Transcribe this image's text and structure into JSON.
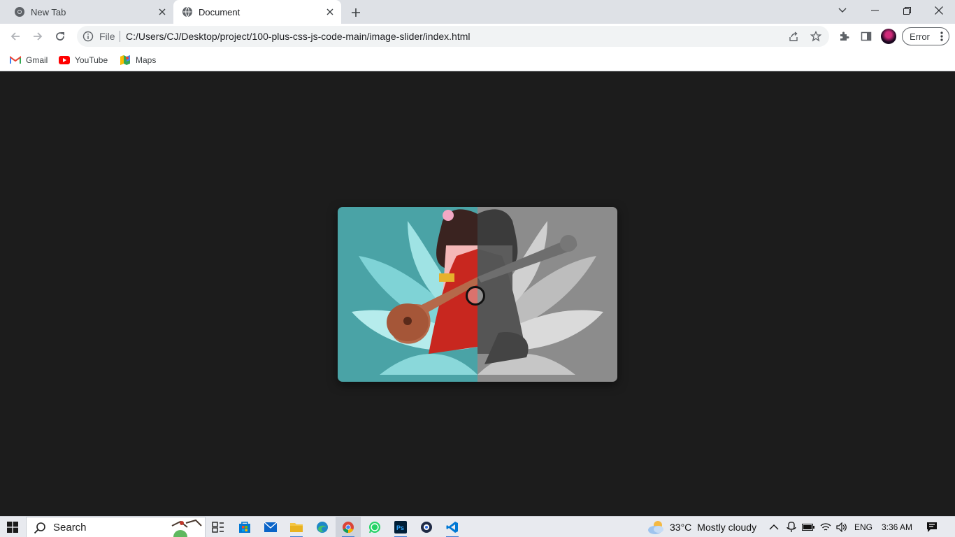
{
  "browser": {
    "tabs": [
      {
        "title": "New Tab",
        "active": false
      },
      {
        "title": "Document",
        "active": true
      }
    ],
    "address": {
      "scheme_label": "File",
      "url": "C:/Users/CJ/Desktop/project/100-plus-css-js-code-main/image-slider/index.html"
    },
    "profile_status": "Error",
    "bookmarks": [
      {
        "label": "Gmail",
        "icon": "gmail-icon"
      },
      {
        "label": "YouTube",
        "icon": "youtube-icon"
      },
      {
        "label": "Maps",
        "icon": "maps-icon"
      }
    ]
  },
  "page": {
    "slider": {
      "description_icon": "compare-slider",
      "handle_position": 0.495
    }
  },
  "taskbar": {
    "search_placeholder": "Search",
    "weather": {
      "temp": "33°C",
      "condition": "Mostly cloudy"
    },
    "language": "ENG",
    "time": "3:36 AM",
    "apps": [
      "task-view-icon",
      "store-icon",
      "mail-icon",
      "file-explorer-icon",
      "edge-icon",
      "chrome-icon",
      "whatsapp-icon",
      "photoshop-icon",
      "app-icon",
      "vscode-icon"
    ]
  }
}
